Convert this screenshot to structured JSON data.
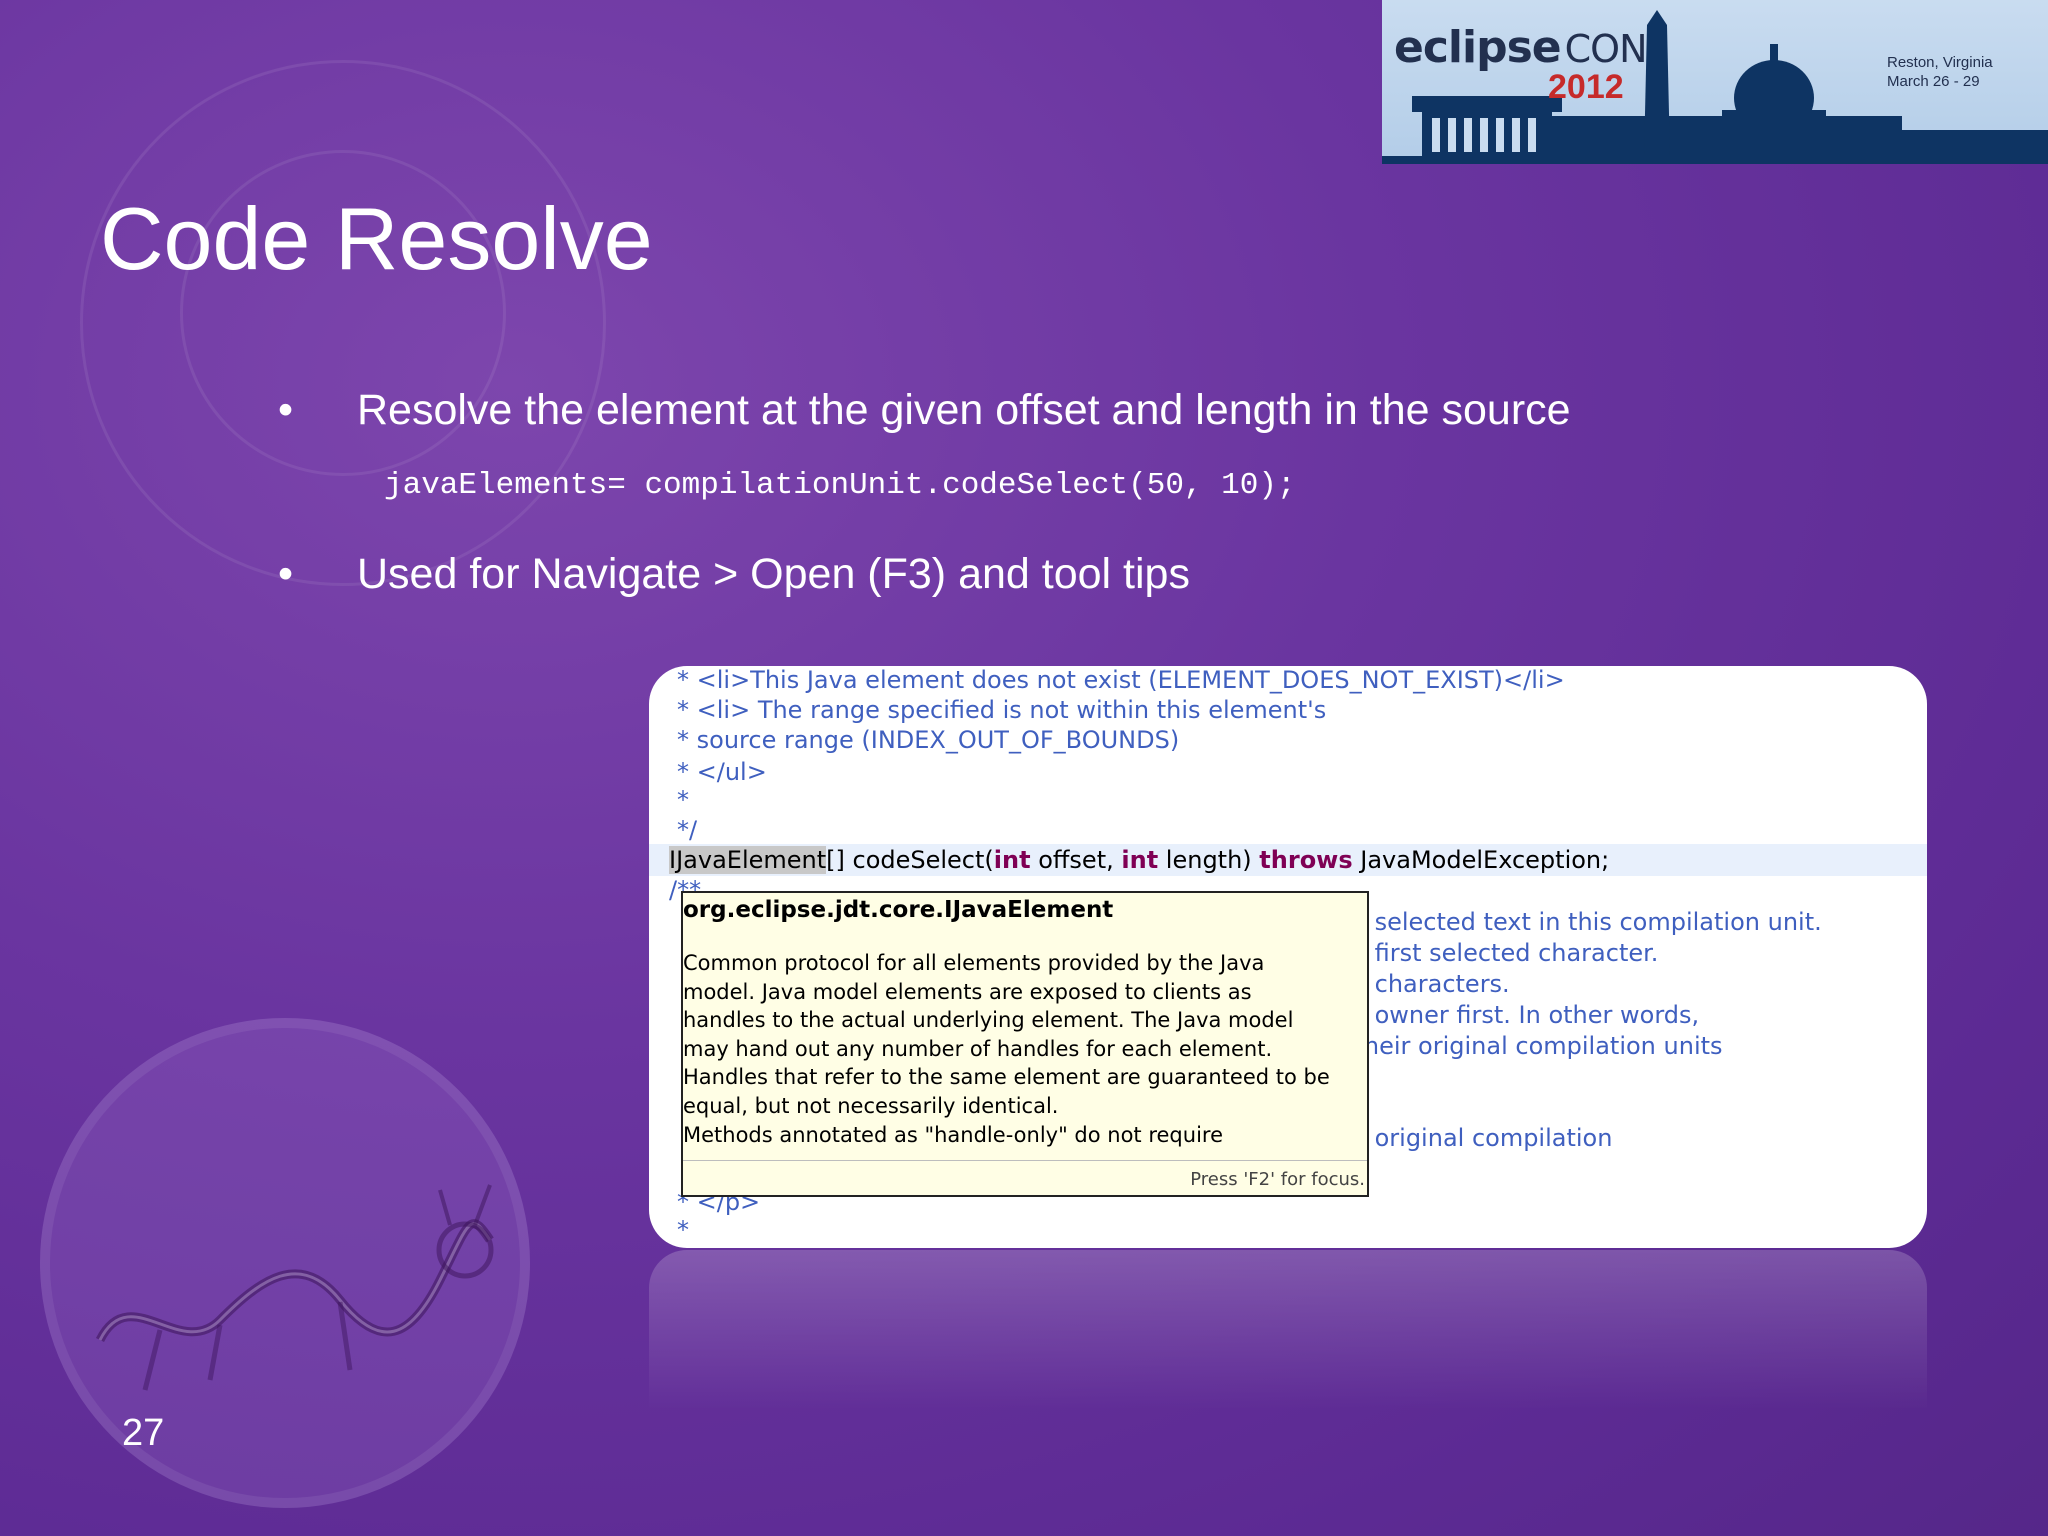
{
  "logo": {
    "brand": "eclipse",
    "brand_suffix": "CON",
    "year": "2012",
    "location": "Reston, Virginia",
    "dates": "March 26 - 29"
  },
  "slide": {
    "title": "Code Resolve",
    "bullets": [
      "Resolve the element at the given offset and length in the source",
      "Used for Navigate > Open (F3) and tool tips"
    ],
    "bullet_glyph": "•",
    "code": "javaElements= compilationUnit.codeSelect(50, 10);",
    "page_number": "27"
  },
  "editor": {
    "lines": [
      "*  <li>This Java element does not exist (ELEMENT_DOES_NOT_EXIST)</li>",
      "*  <li> The range specified is not within this element's",
      "*      source range (INDEX_OUT_OF_BOUNDS)",
      "* </ul>",
      "*",
      "*/"
    ],
    "signature": {
      "selected_type": "IJavaElement",
      "part1": "[] codeSelect(",
      "kw_int1": "int",
      "part2": " offset, ",
      "kw_int2": "int",
      "part3": " length) ",
      "kw_throws": "throws",
      "part4": " JavaModelException;"
    },
    "doc_start": "/**",
    "right_fragments": [
      "en selected text in this compilation unit.",
      "he first selected character.",
      "ed characters.",
      "en owner first. In other words,",
      "r their original compilation units",
      "he original compilation"
    ],
    "tail_lines": [
      "* </p>",
      "*"
    ]
  },
  "hover": {
    "title": "org.eclipse.jdt.core.IJavaElement",
    "body_lines": [
      "Common protocol for all elements provided by the Java",
      " model. Java model elements are exposed to clients as",
      " handles to the actual underlying element. The Java model",
      " may hand out any number of handles for each element.",
      " Handles that refer to the same element are guaranteed to be",
      " equal, but not necessarily identical.",
      "Methods annotated as \"handle-only\" do not require"
    ],
    "footer": "Press 'F2' for focus."
  },
  "colors": {
    "background": "#6a35a0",
    "javadoc_blue": "#3f5fbf",
    "keyword": "#7f0055",
    "hover_bg": "#fffee5",
    "logo_red": "#c62a2a"
  }
}
